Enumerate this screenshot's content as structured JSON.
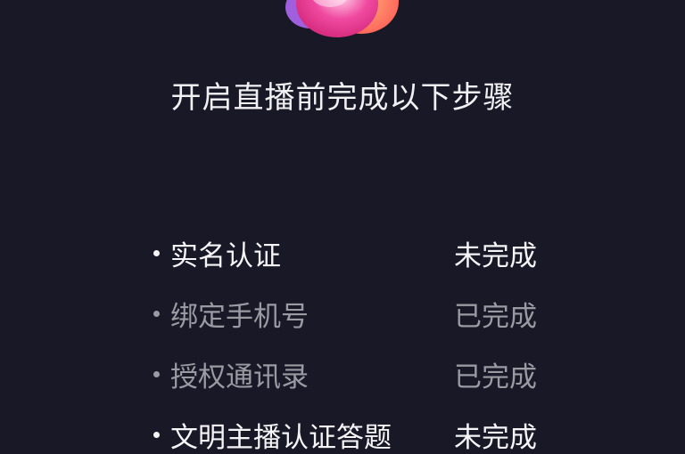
{
  "header": {
    "title": "开启直播前完成以下步骤"
  },
  "steps": [
    {
      "label": "实名认证",
      "status": "未完成",
      "state": "pending"
    },
    {
      "label": "绑定手机号",
      "status": "已完成",
      "state": "done"
    },
    {
      "label": "授权通讯录",
      "status": "已完成",
      "state": "done"
    },
    {
      "label": "文明主播认证答题",
      "status": "未完成",
      "state": "pending"
    }
  ],
  "colors": {
    "background": "#181826",
    "pending_text": "#f5f5f7",
    "done_text": "#9a9aa3",
    "logo_pink": "#f04aa0",
    "logo_orange": "#ff7a45",
    "logo_purple": "#b76cff"
  },
  "icons": {
    "logo": "live-logo-icon"
  }
}
